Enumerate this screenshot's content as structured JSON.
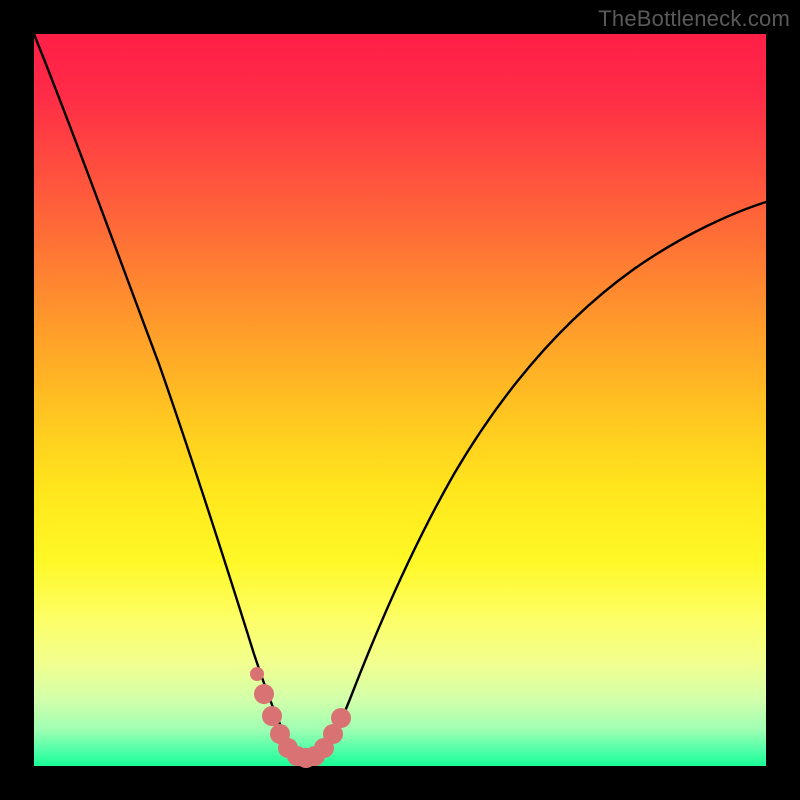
{
  "watermark": "TheBottleneck.com",
  "colors": {
    "frame": "#000000",
    "curve": "#000000",
    "marker": "#d97373",
    "gradient_top": "#ff1f47",
    "gradient_bottom": "#18ff96"
  },
  "chart_data": {
    "type": "line",
    "title": "",
    "xlabel": "",
    "ylabel": "",
    "xlim": [
      0,
      1
    ],
    "ylim": [
      0,
      1
    ],
    "series": [
      {
        "name": "curve",
        "x": [
          0.0,
          0.04,
          0.08,
          0.12,
          0.16,
          0.2,
          0.24,
          0.28,
          0.3,
          0.32,
          0.34,
          0.36,
          0.38,
          0.4,
          0.44,
          0.48,
          0.52,
          0.56,
          0.6,
          0.66,
          0.72,
          0.8,
          0.88,
          0.96,
          1.0
        ],
        "y": [
          1.0,
          0.85,
          0.71,
          0.58,
          0.46,
          0.35,
          0.25,
          0.14,
          0.085,
          0.04,
          0.01,
          0.0,
          0.0,
          0.015,
          0.07,
          0.14,
          0.22,
          0.3,
          0.37,
          0.45,
          0.52,
          0.59,
          0.65,
          0.7,
          0.72
        ]
      }
    ],
    "markers": {
      "name": "highlight-band",
      "color": "#d97373",
      "points": [
        {
          "x": 0.3,
          "y": 0.085
        },
        {
          "x": 0.312,
          "y": 0.055
        },
        {
          "x": 0.325,
          "y": 0.03
        },
        {
          "x": 0.34,
          "y": 0.01
        },
        {
          "x": 0.355,
          "y": 0.0
        },
        {
          "x": 0.37,
          "y": 0.0
        },
        {
          "x": 0.385,
          "y": 0.005
        },
        {
          "x": 0.4,
          "y": 0.02
        },
        {
          "x": 0.415,
          "y": 0.04
        }
      ],
      "isolated_dot": {
        "x": 0.298,
        "y": 0.115
      }
    }
  }
}
